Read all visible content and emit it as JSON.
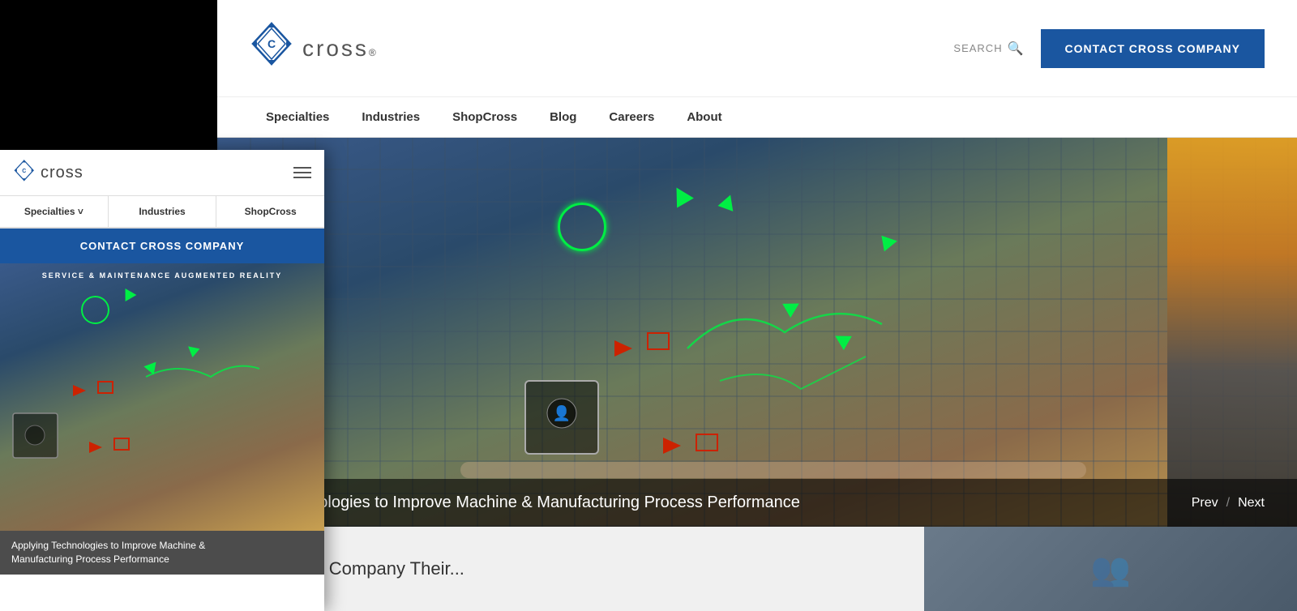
{
  "header": {
    "logo_text": "cross",
    "logo_registered": "®",
    "search_label": "SEARCH",
    "contact_btn": "CONTACT CROSS COMPANY"
  },
  "nav": {
    "items": [
      {
        "label": "Specialties",
        "id": "specialties"
      },
      {
        "label": "Industries",
        "id": "industries"
      },
      {
        "label": "ShopCross",
        "id": "shopcross"
      },
      {
        "label": "Blog",
        "id": "blog"
      },
      {
        "label": "Careers",
        "id": "careers"
      },
      {
        "label": "About",
        "id": "about"
      }
    ]
  },
  "hero": {
    "tablet_label": "SERVICE & MAINTENANCE  AUGMENTED REALITY",
    "caption": "ing Technologies to Improve Machine & Manufacturing Process Performance",
    "nav_prev": "Prev",
    "nav_next": "Next",
    "nav_divider": "/"
  },
  "mobile": {
    "logo_text": "cross",
    "hamburger_label": "Menu",
    "nav_items": [
      {
        "label": "Specialties ˅"
      },
      {
        "label": "Industries"
      },
      {
        "label": "ShopCross"
      }
    ],
    "contact_btn": "CONTACT CROSS COMPANY",
    "hero_label": "SERVICE & MAINTENANCE  AUGMENTED REALITY",
    "caption_line1": "Applying Technologies to Improve Machine &",
    "caption_line2": "Manufacturing Process Performance"
  }
}
